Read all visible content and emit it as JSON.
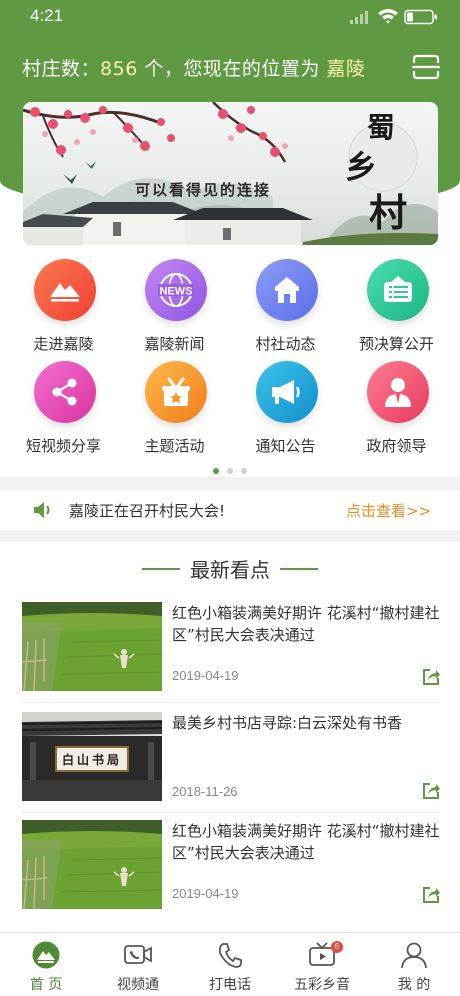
{
  "status_bar": {
    "time": "4:21"
  },
  "header": {
    "location_prefix": "村庄数：",
    "village_count": "856",
    "location_mid": " 个，您现在的位置为 ",
    "location_name": "嘉陵"
  },
  "banner": {
    "slogan": "可以看得见的连接",
    "title_chars": [
      "蜀",
      "乡",
      "村"
    ]
  },
  "grid": {
    "items": [
      {
        "label": "走进嘉陵",
        "icon": "mountain-icon",
        "color": "#f25a3c"
      },
      {
        "label": "嘉陵新闻",
        "icon": "news-globe-icon",
        "color": "#a66ae6"
      },
      {
        "label": "村社动态",
        "icon": "house-icon",
        "color": "#6d82f0"
      },
      {
        "label": "预决算公开",
        "icon": "notice-board-icon",
        "color": "#2ec99a"
      },
      {
        "label": "短视频分享",
        "icon": "share-icon",
        "color": "#e94bb5"
      },
      {
        "label": "主题活动",
        "icon": "activity-star-icon",
        "color": "#f49a2a"
      },
      {
        "label": "通知公告",
        "icon": "megaphone-icon",
        "color": "#1fa8d8"
      },
      {
        "label": "政府领导",
        "icon": "leader-icon",
        "color": "#f0506c"
      }
    ],
    "news_badge_text": "NEWS"
  },
  "notice": {
    "text": "嘉陵正在召开村民大会!",
    "link": "点击查看>>"
  },
  "news": {
    "section_title": "最新看点",
    "items": [
      {
        "title": "红色小箱装满美好期许 花溪村“撤村建社区”村民大会表决通过",
        "date": "2019-04-19"
      },
      {
        "title": "最美乡村书店寻踪:白云深处有书香",
        "date": "2018-11-26",
        "sign_text": "白山书局"
      },
      {
        "title": "红色小箱装满美好期许 花溪村“撤村建社区”村民大会表决通过",
        "date": "2019-04-19"
      }
    ]
  },
  "tabbar": {
    "tabs": [
      {
        "label": "首 页",
        "icon": "home-mountain-icon",
        "active": true
      },
      {
        "label": "视频通",
        "icon": "video-call-icon"
      },
      {
        "label": "打电话",
        "icon": "phone-icon"
      },
      {
        "label": "五彩乡音",
        "icon": "tv-icon",
        "badge": "6"
      },
      {
        "label": "我 的",
        "icon": "user-icon"
      }
    ]
  },
  "colors": {
    "brand_green": "#5f9a43",
    "highlight": "#fff3a8",
    "link_orange": "#f08a24"
  }
}
